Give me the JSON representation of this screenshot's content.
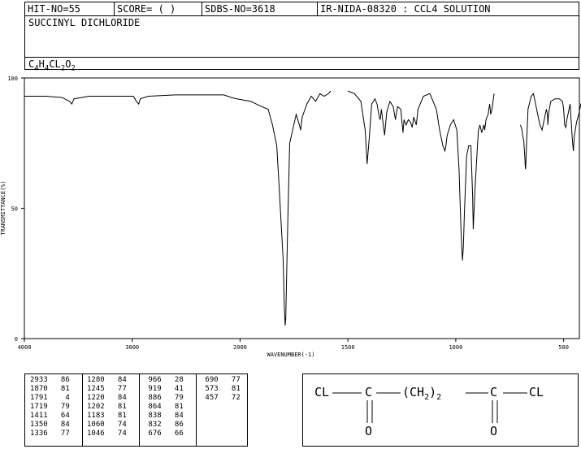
{
  "header": {
    "hit_no": "HIT-NO=55",
    "score": "SCORE=  (   )",
    "sdbs_no": "SDBS-NO=3618",
    "ir_info": "IR-NIDA-08320 : CCL4 SOLUTION",
    "compound_name": "SUCCINYL DICHLORIDE",
    "formula_parts": [
      "C",
      "4",
      "H",
      "4",
      "CL",
      "2",
      "O",
      "2"
    ]
  },
  "chart_data": {
    "type": "line",
    "xlabel": "WAVENUMBER(-1)",
    "ylabel": "TRANSMITTANCE(%)",
    "xlim": [
      4000,
      400
    ],
    "ylim": [
      0,
      100
    ],
    "x_ticks": [
      4000,
      3000,
      2000,
      1500,
      1000,
      500
    ],
    "x_tick_labels": [
      "4000",
      "3000",
      "2000",
      "1500",
      "1000",
      "500"
    ],
    "y_ticks": [
      0,
      50,
      100
    ],
    "y_tick_labels": [
      "0",
      "50",
      "100"
    ],
    "series": [
      {
        "segments": [
          [
            [
              4000,
              93
            ],
            [
              3800,
              93
            ],
            [
              3650,
              92.5
            ],
            [
              3580,
              91
            ],
            [
              3560,
              90
            ],
            [
              3540,
              92
            ],
            [
              3400,
              93
            ],
            [
              3200,
              93
            ],
            [
              2990,
              93
            ],
            [
              2960,
              91
            ],
            [
              2940,
              90
            ],
            [
              2925,
              92
            ],
            [
              2850,
              93
            ],
            [
              2600,
              93.5
            ],
            [
              2300,
              93.5
            ],
            [
              2150,
              93.5
            ],
            [
              2080,
              92.5
            ],
            [
              2030,
              92
            ],
            [
              1950,
              91
            ],
            [
              1900,
              89
            ],
            [
              1870,
              88
            ],
            [
              1850,
              82
            ],
            [
              1830,
              74
            ],
            [
              1820,
              60
            ],
            [
              1800,
              30
            ],
            [
              1795,
              12
            ],
            [
              1791,
              5
            ],
            [
              1788,
              8
            ],
            [
              1780,
              40
            ],
            [
              1770,
              75
            ],
            [
              1740,
              86
            ],
            [
              1725,
              82
            ],
            [
              1719,
              80
            ],
            [
              1712,
              85
            ],
            [
              1690,
              90
            ],
            [
              1670,
              93
            ],
            [
              1650,
              91
            ],
            [
              1630,
              94
            ],
            [
              1610,
              93
            ],
            [
              1590,
              94
            ],
            [
              1580,
              95
            ]
          ],
          [
            [
              1500,
              95
            ],
            [
              1470,
              94
            ],
            [
              1440,
              91
            ],
            [
              1420,
              80
            ],
            [
              1411,
              67
            ],
            [
              1400,
              78
            ],
            [
              1390,
              90
            ],
            [
              1375,
              92
            ],
            [
              1365,
              90
            ],
            [
              1355,
              85
            ],
            [
              1350,
              84
            ],
            [
              1345,
              88
            ],
            [
              1336,
              82
            ],
            [
              1330,
              78
            ],
            [
              1320,
              87
            ],
            [
              1305,
              91
            ],
            [
              1290,
              89
            ],
            [
              1280,
              84
            ],
            [
              1270,
              89
            ],
            [
              1255,
              88
            ],
            [
              1245,
              79
            ],
            [
              1240,
              84
            ],
            [
              1230,
              82
            ],
            [
              1220,
              84
            ],
            [
              1210,
              83
            ],
            [
              1202,
              81
            ],
            [
              1195,
              85
            ],
            [
              1183,
              82
            ],
            [
              1175,
              88
            ],
            [
              1150,
              93
            ],
            [
              1120,
              94
            ],
            [
              1090,
              88
            ],
            [
              1075,
              80
            ],
            [
              1060,
              74
            ],
            [
              1050,
              72
            ],
            [
              1046,
              74
            ],
            [
              1040,
              78
            ],
            [
              1025,
              82
            ],
            [
              1010,
              84
            ],
            [
              995,
              80
            ],
            [
              985,
              65
            ],
            [
              975,
              40
            ],
            [
              969,
              30
            ],
            [
              965,
              35
            ],
            [
              960,
              48
            ],
            [
              950,
              70
            ],
            [
              940,
              74
            ],
            [
              930,
              74
            ],
            [
              922,
              55
            ],
            [
              919,
              42
            ],
            [
              912,
              56
            ],
            [
              900,
              73
            ],
            [
              895,
              80
            ],
            [
              888,
              82
            ],
            [
              880,
              79
            ],
            [
              870,
              82
            ],
            [
              866,
              80
            ],
            [
              860,
              84
            ],
            [
              850,
              86
            ],
            [
              843,
              90
            ],
            [
              838,
              86
            ],
            [
              832,
              88
            ],
            [
              826,
              92
            ],
            [
              822,
              94
            ]
          ],
          [
            [
              700,
              82
            ],
            [
              693,
              80
            ],
            [
              690,
              78
            ],
            [
              685,
              76
            ],
            [
              680,
              70
            ],
            [
              678,
              66
            ],
            [
              676,
              65
            ],
            [
              672,
              75
            ],
            [
              665,
              88
            ],
            [
              650,
              93
            ],
            [
              640,
              94
            ],
            [
              630,
              90
            ],
            [
              610,
              82
            ],
            [
              600,
              80
            ],
            [
              595,
              82
            ],
            [
              580,
              88
            ],
            [
              575,
              86
            ],
            [
              573,
              82
            ],
            [
              570,
              86
            ],
            [
              560,
              91
            ],
            [
              540,
              92
            ],
            [
              520,
              92
            ],
            [
              505,
              91
            ],
            [
              500,
              88
            ],
            [
              495,
              82
            ],
            [
              490,
              81
            ],
            [
              485,
              84
            ],
            [
              470,
              90
            ],
            [
              460,
              77
            ],
            [
              457,
              74
            ],
            [
              455,
              72
            ],
            [
              450,
              78
            ],
            [
              440,
              83
            ],
            [
              430,
              86
            ],
            [
              420,
              90
            ],
            [
              410,
              92
            ],
            [
              400,
              92
            ]
          ]
        ]
      }
    ],
    "peak_table": [
      [
        "2933",
        "86"
      ],
      [
        "1870",
        "81"
      ],
      [
        "1791",
        "4"
      ],
      [
        "1719",
        "79"
      ],
      [
        "1411",
        "64"
      ],
      [
        "1350",
        "84"
      ],
      [
        "1336",
        "77"
      ],
      [
        "1280",
        "84"
      ],
      [
        "1245",
        "77"
      ],
      [
        "1220",
        "84"
      ],
      [
        "1202",
        "81"
      ],
      [
        "1183",
        "81"
      ],
      [
        "1060",
        "74"
      ],
      [
        "1046",
        "74"
      ],
      [
        "966",
        "28"
      ],
      [
        "919",
        "41"
      ],
      [
        "886",
        "79"
      ],
      [
        "864",
        "81"
      ],
      [
        "838",
        "84"
      ],
      [
        "832",
        "86"
      ],
      [
        "676",
        "66"
      ],
      [
        "690",
        "77"
      ],
      [
        "573",
        "81"
      ],
      [
        "457",
        "72"
      ]
    ]
  },
  "structure": {
    "cl_left": "CL",
    "c_left": "C",
    "group": "(CH",
    "group_sub": "2",
    "group_close": ")",
    "group_count": "2",
    "c_right": "C",
    "cl_right": "CL",
    "o_left": "O",
    "o_right": "O"
  }
}
